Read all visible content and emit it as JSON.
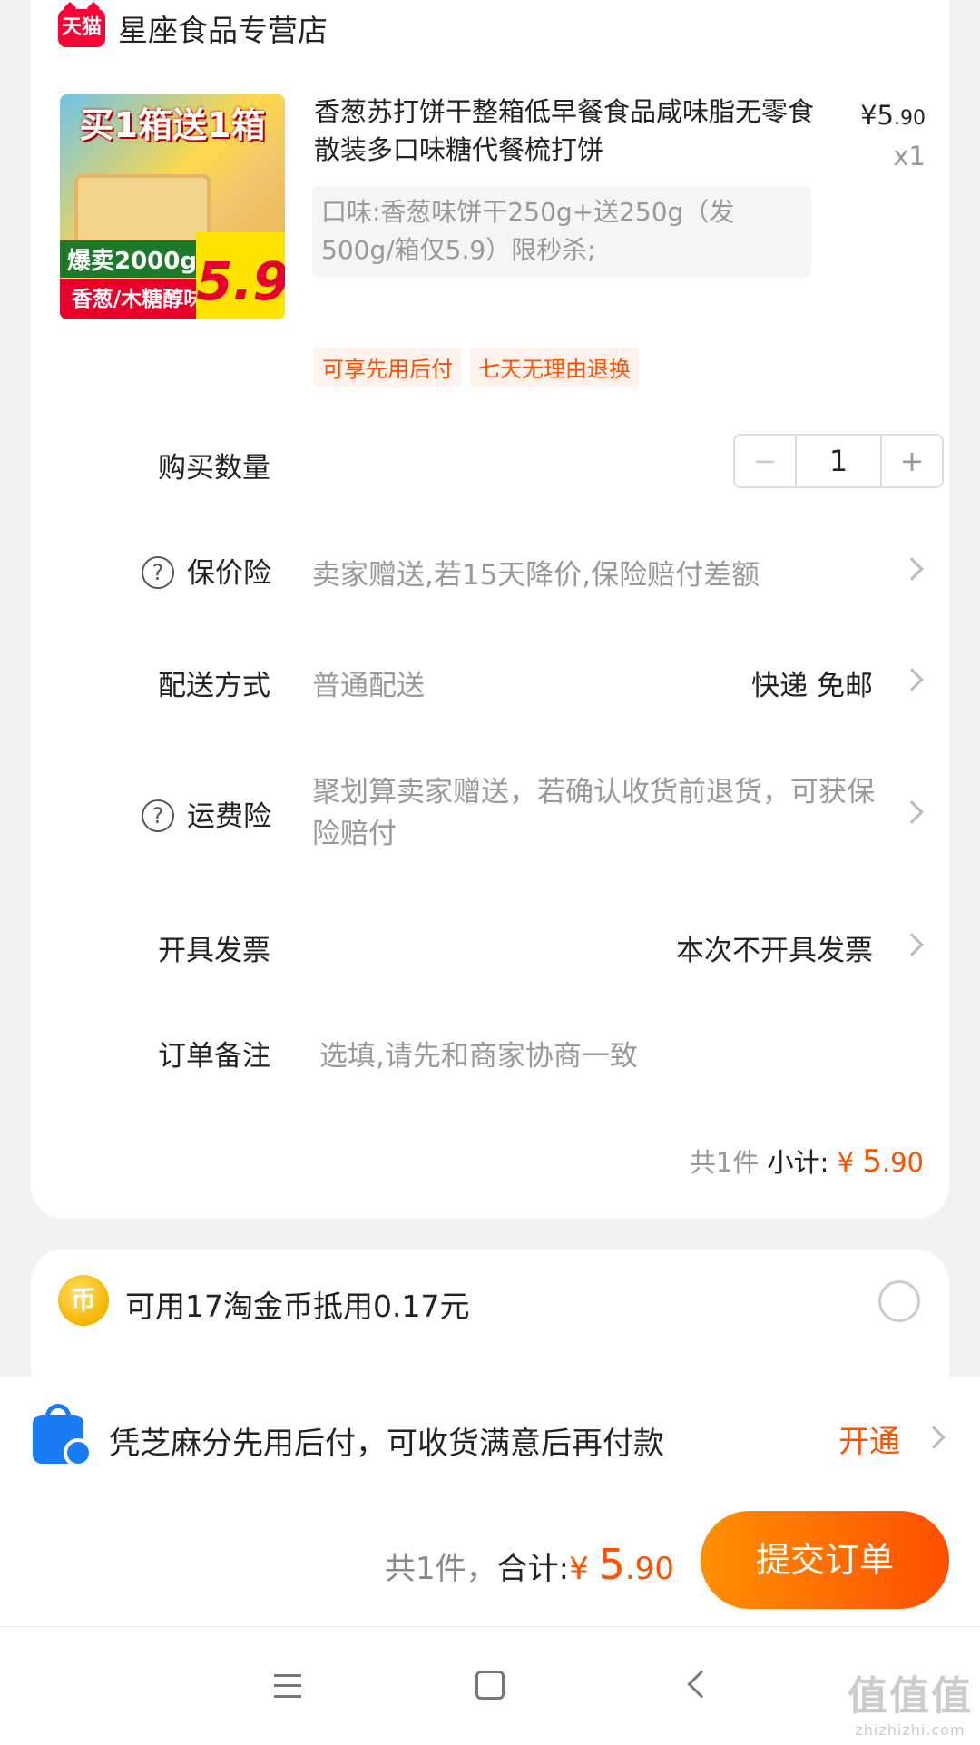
{
  "shop": {
    "badge": "天猫",
    "name": "星座食品专营店"
  },
  "product": {
    "image_banner": "买1箱送1箱",
    "image_sold": "爆卖2000g",
    "image_flavor": "香葱/木糖醇味",
    "image_price": "5.9",
    "title": "香葱苏打饼干整箱低早餐食品咸味脂无零食散装多口味糖代餐梳打饼",
    "price_symbol": "¥",
    "price_int": "5",
    "price_dec": ".90",
    "quantity": "x1",
    "sku": "口味:香葱味饼干250g+送250g（发500g/箱仅5.9）限秒杀;",
    "tags": [
      "可享先用后付",
      "七天无理由退换"
    ]
  },
  "rows": {
    "qty_label": "购买数量",
    "qty_minus": "−",
    "qty_value": "1",
    "qty_plus": "+",
    "price_ins_label": "保价险",
    "price_ins_value": "卖家赠送,若15天降价,保险赔付差额",
    "delivery_label": "配送方式",
    "delivery_value": "普通配送",
    "delivery_right": "快递 免邮",
    "freight_ins_label": "运费险",
    "freight_ins_value": "聚划算卖家赠送，若确认收货前退货，可获保险赔付",
    "invoice_label": "开具发票",
    "invoice_right": "本次不开具发票",
    "note_label": "订单备注",
    "note_placeholder": "选填,请先和商家协商一致",
    "question_mark": "?"
  },
  "subtotal": {
    "count": "共1件",
    "label": "小计:",
    "symbol": "¥",
    "int": "5",
    "dec": ".90"
  },
  "coin": {
    "icon": "币",
    "text": "可用17淘金币抵用0.17元"
  },
  "zhima": {
    "text": "凭芝麻分先用后付，可收货满意后再付款",
    "link": "开通"
  },
  "footer": {
    "count": "共1件，",
    "label": "合计:",
    "symbol": "¥",
    "int": "5",
    "dec": ".90",
    "submit": "提交订单"
  },
  "watermark": {
    "main": "值值值",
    "sub": "zhizhizhi.com"
  }
}
